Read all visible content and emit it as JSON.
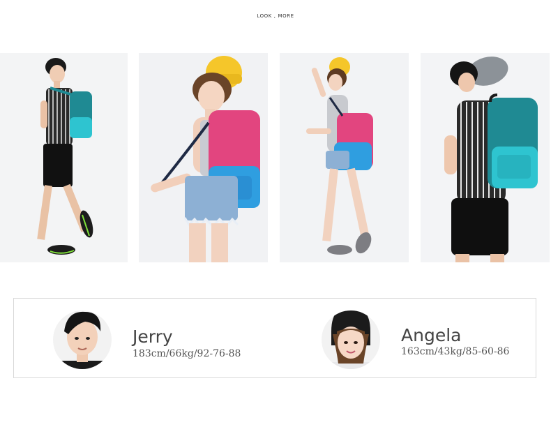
{
  "section": {
    "heading": "LOOK , MORE"
  },
  "photos": [
    {
      "subject": "Jerry with teal backpack, side view"
    },
    {
      "subject": "Angela with pink-blue backpack, yellow beanie"
    },
    {
      "subject": "Angela full body with pink-blue backpack"
    },
    {
      "subject": "Jerry with teal backpack, grey beanie, back view"
    }
  ],
  "models": [
    {
      "name": "Jerry",
      "stats": "183cm/66kg/92-76-88"
    },
    {
      "name": "Angela",
      "stats": "163cm/43kg/85-60-86"
    }
  ],
  "colors": {
    "teal_bag": "#1f8a93",
    "aqua_pocket": "#2ec4d0",
    "pink_bag": "#e2457f",
    "blue_pocket": "#2f9ee0",
    "yellow_hat": "#f5c62a",
    "grey_hat": "#8c9298",
    "border": "#d9d9d9"
  }
}
